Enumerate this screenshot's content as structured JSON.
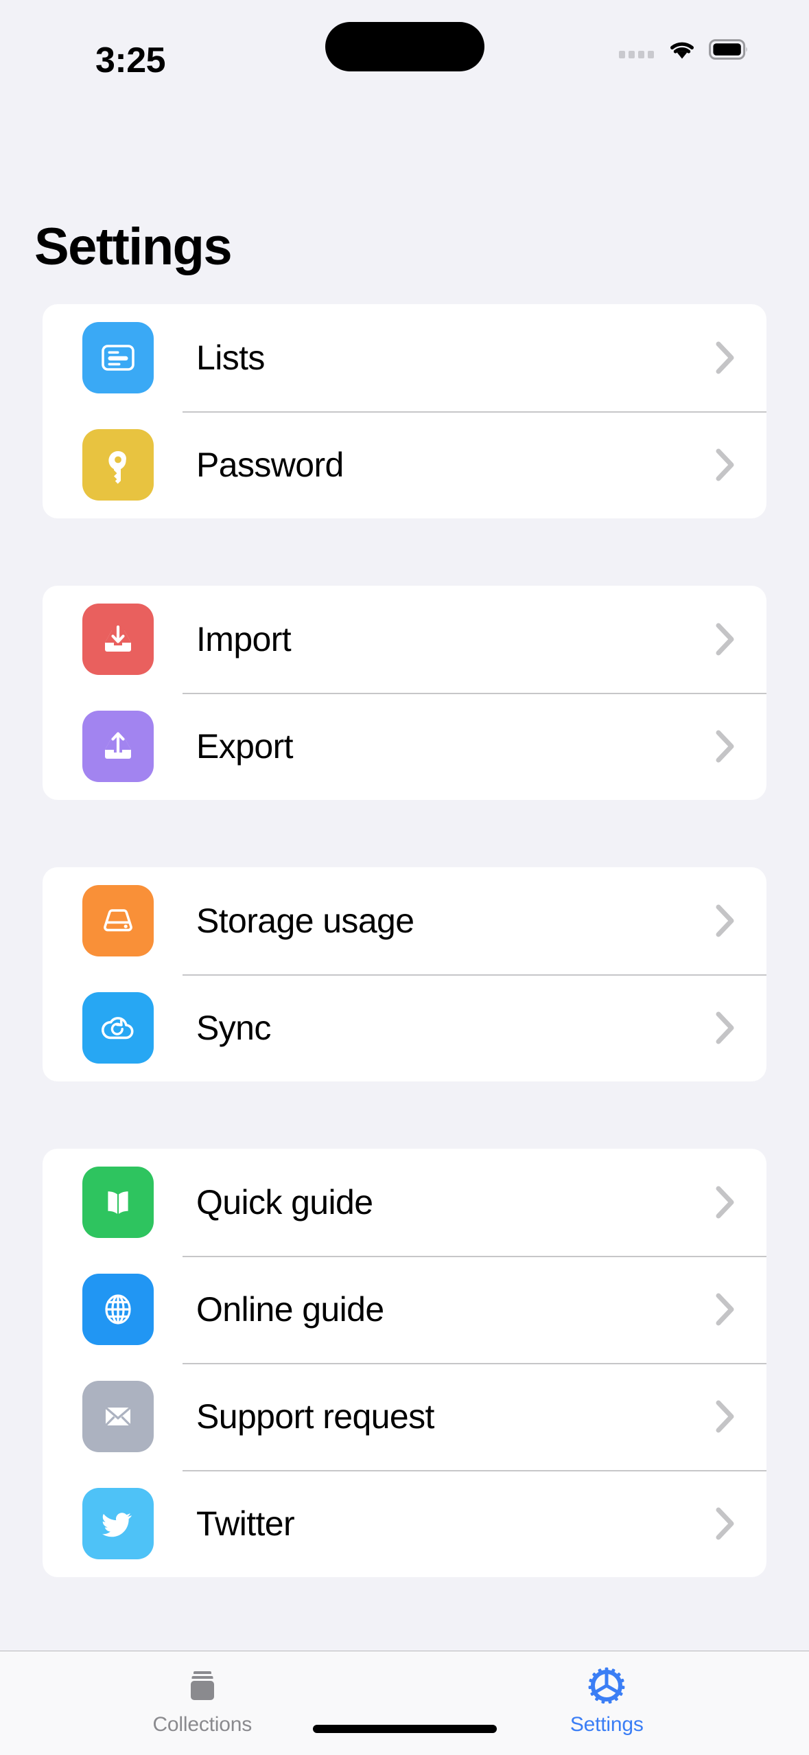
{
  "status_bar": {
    "time": "3:25",
    "icons": [
      "cellular-dots-icon",
      "wifi-icon",
      "battery-icon"
    ]
  },
  "header": {
    "title": "Settings"
  },
  "colors": {
    "page_background": "#f2f2f7",
    "card_background": "#ffffff",
    "separator": "#c6c6c8",
    "chevron": "#c4c4c6",
    "accent": "#3b7ef5",
    "tab_inactive": "#8a8a8e"
  },
  "groups": [
    {
      "rows": [
        {
          "label": "Lists",
          "icon": "list-card-icon",
          "icon_color": "#3aa9f5",
          "chevron": "chevron-right-icon"
        },
        {
          "label": "Password",
          "icon": "key-icon",
          "icon_color": "#e8c03e",
          "chevron": "chevron-right-icon"
        }
      ]
    },
    {
      "rows": [
        {
          "label": "Import",
          "icon": "tray-arrow-down-icon",
          "icon_color": "#e9605e",
          "chevron": "chevron-right-icon"
        },
        {
          "label": "Export",
          "icon": "tray-arrow-up-icon",
          "icon_color": "#a островки"
        }
      ]
    }
  ],
  "tab_bar": {
    "tabs": [
      {
        "label": "Collections",
        "icon": "stack-icon",
        "active": false
      },
      {
        "label": "Settings",
        "icon": "gear-icon",
        "active": true
      }
    ]
  }
}
